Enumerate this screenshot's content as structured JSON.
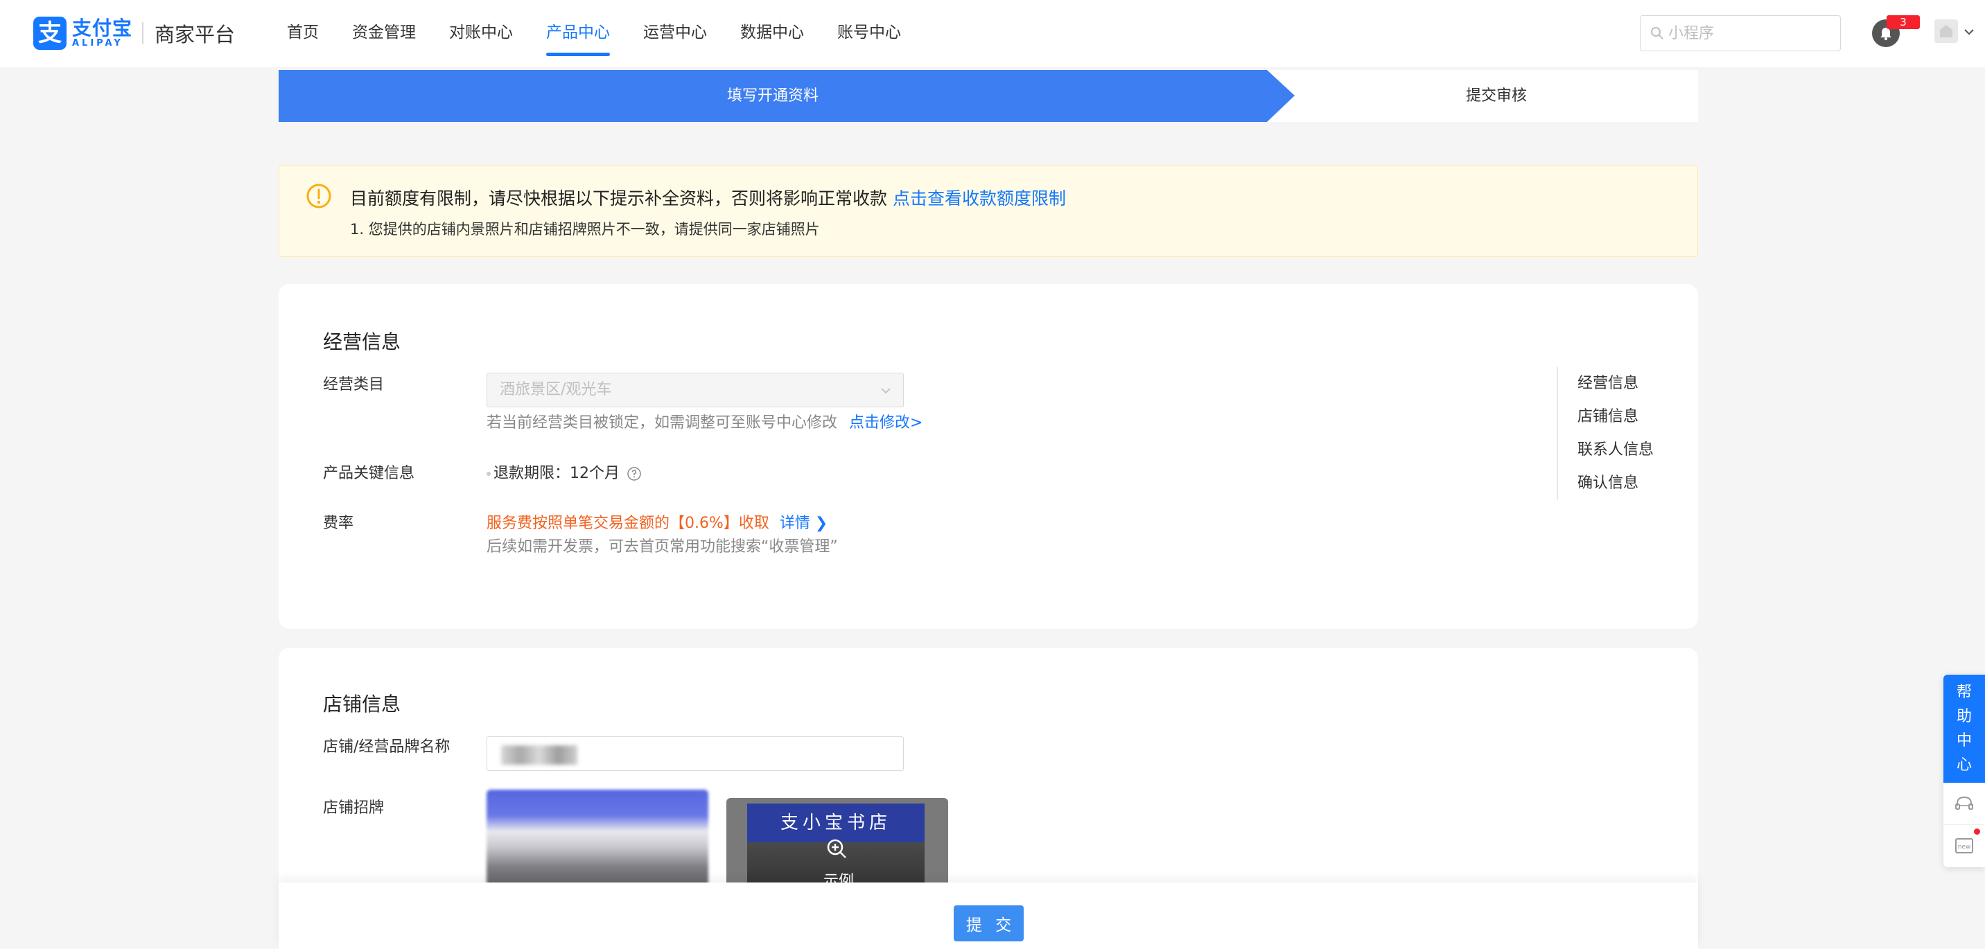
{
  "header": {
    "logo_cn": "支付宝",
    "logo_en": "ALIPAY",
    "platform": "商家平台",
    "nav": [
      {
        "label": "首页"
      },
      {
        "label": "资金管理"
      },
      {
        "label": "对账中心"
      },
      {
        "label": "产品中心",
        "active": true
      },
      {
        "label": "运营中心"
      },
      {
        "label": "数据中心"
      },
      {
        "label": "账号中心"
      }
    ],
    "search_placeholder": "小程序",
    "notification_count": "3"
  },
  "steps": [
    {
      "label": "填写开通资料",
      "active": true
    },
    {
      "label": "提交审核",
      "active": false
    }
  ],
  "alert": {
    "title": "目前额度有限制，请尽快根据以下提示补全资料，否则将影响正常收款",
    "link": "点击查看收款额度限制",
    "items": [
      "1. 您提供的店铺内景照片和店铺招牌照片不一致，请提供同一家店铺照片"
    ]
  },
  "business": {
    "title": "经营信息",
    "category_label": "经营类目",
    "category_value": "酒旅景区/观光车",
    "category_hint": "若当前经营类目被锁定，如需调整可至账号中心修改",
    "category_link": "点击修改>",
    "key_info_label": "产品关键信息",
    "key_info_value": "退款期限：12个月",
    "fee_label": "费率",
    "fee_text": "服务费按照单笔交易金额的【0.6%】收取",
    "fee_link": "详情",
    "fee_hint": "后续如需开发票，可去首页常用功能搜索“收票管理”"
  },
  "side_nav": [
    {
      "label": "经营信息"
    },
    {
      "label": "店铺信息"
    },
    {
      "label": "联系人信息"
    },
    {
      "label": "确认信息"
    }
  ],
  "shop": {
    "title": "店铺信息",
    "name_label": "店铺/经营品牌名称",
    "sign_label": "店铺招牌",
    "example_banner": "支小宝书店",
    "example_label": "示例"
  },
  "footer": {
    "submit": "提 交"
  },
  "help": {
    "label": [
      "帮",
      "助",
      "中",
      "心"
    ]
  },
  "colors": {
    "primary": "#1677ff",
    "step_active": "#3d7ef2",
    "warning_bg": "#fffbe6",
    "warning_icon": "#faad14",
    "fee_orange": "#f2621f",
    "badge_red": "#f5222d"
  }
}
